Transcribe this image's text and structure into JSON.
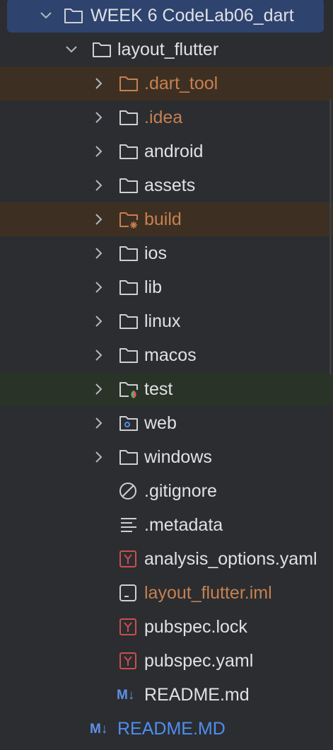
{
  "project": {
    "label": "WEEK 6 CodeLab06_dart"
  },
  "module": {
    "label": "layout_flutter"
  },
  "folders": [
    {
      "label": ".dart_tool",
      "kind": "excluded"
    },
    {
      "label": ".idea",
      "kind": "ignored"
    },
    {
      "label": "android",
      "kind": "normal"
    },
    {
      "label": "assets",
      "kind": "normal"
    },
    {
      "label": "build",
      "kind": "excluded-build"
    },
    {
      "label": "ios",
      "kind": "normal"
    },
    {
      "label": "lib",
      "kind": "normal"
    },
    {
      "label": "linux",
      "kind": "normal"
    },
    {
      "label": "macos",
      "kind": "normal"
    },
    {
      "label": "test",
      "kind": "test"
    },
    {
      "label": "web",
      "kind": "web"
    },
    {
      "label": "windows",
      "kind": "normal"
    }
  ],
  "files": [
    {
      "label": ".gitignore",
      "icon": "ignore-file-icon"
    },
    {
      "label": ".metadata",
      "icon": "text-file-icon"
    },
    {
      "label": "analysis_options.yaml",
      "icon": "yaml-file-icon"
    },
    {
      "label": "layout_flutter.iml",
      "icon": "iml-file-icon"
    },
    {
      "label": "pubspec.lock",
      "icon": "yaml-file-icon"
    },
    {
      "label": "pubspec.yaml",
      "icon": "yaml-file-icon"
    },
    {
      "label": "README.md",
      "icon": "markdown-file-icon"
    }
  ],
  "root_files": [
    {
      "label": "README.MD",
      "icon": "markdown-file-icon"
    }
  ],
  "markdown_badge": "M↓",
  "colors": {
    "background": "#2b2d30",
    "selection": "#2e436e",
    "excluded_row": "#3d3023",
    "test_row": "#2a3327",
    "text": "#dfe1e5",
    "excluded_text": "#c7804f",
    "markdown_blue": "#5f91e8",
    "yaml_red": "#c94f4f"
  }
}
